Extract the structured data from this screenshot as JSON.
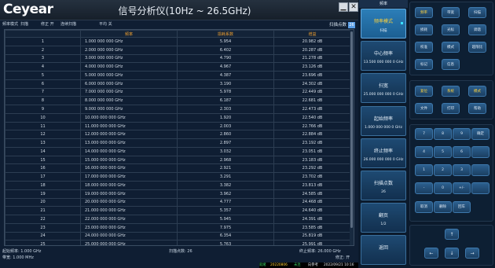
{
  "window": {
    "logo": "Ceyear",
    "title": "信号分析仪(10Hz ~ 26.5GHz)",
    "minimize_icon": "▁",
    "close_icon": "✕"
  },
  "status": {
    "mode": "频率模式",
    "mode_val": "扫描",
    "corr": "修正 开",
    "sweep": "连续扫描",
    "avg": "平均 关"
  },
  "points": {
    "label": "扫描点数",
    "value": "26"
  },
  "table": {
    "headers": [
      "",
      "频率",
      "损耗系数",
      "增益"
    ],
    "rows": [
      [
        "1",
        "1.000 000 000 GHz",
        "5.954",
        "20.982 dB"
      ],
      [
        "2",
        "2.000 000 000 GHz",
        "6.402",
        "20.287 dB"
      ],
      [
        "3",
        "3.000 000 000 GHz",
        "4.790",
        "21.278 dB"
      ],
      [
        "4",
        "4.000 000 000 GHz",
        "4.967",
        "23.126 dB"
      ],
      [
        "5",
        "5.000 000 000 GHz",
        "4.387",
        "23.696 dB"
      ],
      [
        "6",
        "6.000 000 000 GHz",
        "3.190",
        "24.302 dB"
      ],
      [
        "7",
        "7.000 000 000 GHz",
        "5.978",
        "22.449 dB"
      ],
      [
        "8",
        "8.000 000 000 GHz",
        "6.187",
        "22.681 dB"
      ],
      [
        "9",
        "9.000 000 000 GHz",
        "2.303",
        "22.473 dB"
      ],
      [
        "10",
        "10.000 000 000 GHz",
        "1.920",
        "22.540 dB"
      ],
      [
        "11",
        "11.000 000 000 GHz",
        "2.003",
        "22.766 dB"
      ],
      [
        "12",
        "12.000 000 000 GHz",
        "2.860",
        "22.884 dB"
      ],
      [
        "13",
        "13.000 000 000 GHz",
        "2.897",
        "23.192 dB"
      ],
      [
        "14",
        "14.000 000 000 GHz",
        "3.032",
        "23.051 dB"
      ],
      [
        "15",
        "15.000 000 000 GHz",
        "2.968",
        "23.183 dB"
      ],
      [
        "16",
        "16.000 000 000 GHz",
        "2.921",
        "23.292 dB"
      ],
      [
        "17",
        "17.000 000 000 GHz",
        "3.291",
        "23.702 dB"
      ],
      [
        "18",
        "18.000 000 000 GHz",
        "3.382",
        "23.813 dB"
      ],
      [
        "19",
        "19.000 000 000 GHz",
        "3.962",
        "24.585 dB"
      ],
      [
        "20",
        "20.000 000 000 GHz",
        "4.777",
        "24.468 dB"
      ],
      [
        "21",
        "21.000 000 000 GHz",
        "5.357",
        "24.640 dB"
      ],
      [
        "22",
        "22.000 000 000 GHz",
        "5.945",
        "24.391 dB"
      ],
      [
        "23",
        "23.000 000 000 GHz",
        "7.975",
        "23.585 dB"
      ],
      [
        "24",
        "24.000 000 000 GHz",
        "6.354",
        "25.819 dB"
      ],
      [
        "25",
        "25.000 000 000 GHz",
        "5.763",
        "25.991 dB"
      ]
    ]
  },
  "footer": {
    "start": "起始频率: 1.000 GHz",
    "points": "扫描点数: 26",
    "stop": "终止频率: 26.000 GHz",
    "bw": "带宽: 1.000 MHz",
    "corr": "修正: 开"
  },
  "softkeys": {
    "header": "频率",
    "items": [
      {
        "label": "频率模式",
        "value": "扫描"
      },
      {
        "label": "中心频率",
        "value": "13.500 000 000 0 GHz"
      },
      {
        "label": "扫宽",
        "value": "25.000 000 000 0 GHz"
      },
      {
        "label": "起始频率",
        "value": "1.000 000 000 0 GHz"
      },
      {
        "label": "终止频率",
        "value": "26.000 000 000 0 GHz"
      },
      {
        "label": "扫描点数",
        "value": "26"
      },
      {
        "label": "翻页",
        "value": "1/2"
      },
      {
        "label": "返回",
        "value": ""
      }
    ]
  },
  "keypad": {
    "group1": [
      "频率",
      "带宽",
      "扫描",
      "损耗",
      "光标",
      "调谐",
      "校准",
      "模式",
      "超限比",
      "标记",
      "信息"
    ],
    "group2": [
      "复位",
      "系统",
      "模式",
      "文件",
      "打印",
      "帮助"
    ],
    "numbers": [
      "7",
      "8",
      "9",
      "确定",
      "4",
      "5",
      "6",
      "",
      "1",
      "2",
      "3",
      "",
      "-",
      "0",
      "+/-",
      "",
      "取消",
      "删除",
      "回车"
    ],
    "arrows": {
      "up": "↑",
      "left": "←",
      "enter": "↓",
      "right": "→"
    }
  },
  "taskbar": {
    "a": "就绪",
    "b": "20220806",
    "c": "未连",
    "d": "向参考",
    "e": "2022/09/21 10:16"
  }
}
